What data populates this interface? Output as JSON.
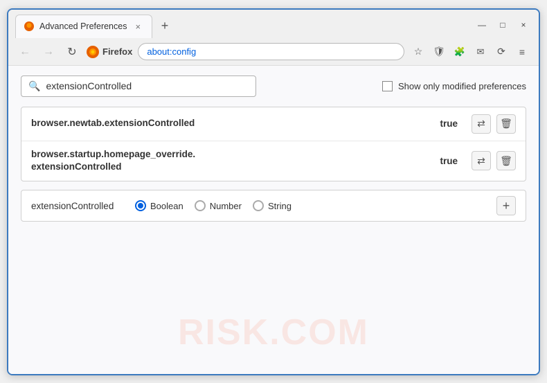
{
  "window": {
    "title": "Advanced Preferences",
    "tab_close": "×",
    "tab_new": "+",
    "win_min": "—",
    "win_max": "□",
    "win_close": "×"
  },
  "navbar": {
    "back_icon": "←",
    "forward_icon": "→",
    "reload_icon": "↻",
    "browser_label": "Firefox",
    "address": "about:config",
    "bookmark_icon": "☆",
    "shield_icon": "🛡",
    "extension_icon": "🧩",
    "mail_icon": "✉",
    "sync_icon": "⟳",
    "menu_icon": "≡"
  },
  "search": {
    "placeholder": "extensionControlled",
    "value": "extensionControlled",
    "show_modified_label": "Show only modified preferences"
  },
  "preferences": [
    {
      "name": "browser.newtab.extensionControlled",
      "value": "true"
    },
    {
      "name": "browser.startup.homepage_override.\nextensionControlled",
      "value": "true",
      "multiline": true,
      "name_line1": "browser.startup.homepage_override.",
      "name_line2": "extensionControlled"
    }
  ],
  "add_pref": {
    "name": "extensionControlled",
    "radio_options": [
      {
        "label": "Boolean",
        "selected": true
      },
      {
        "label": "Number",
        "selected": false
      },
      {
        "label": "String",
        "selected": false
      }
    ],
    "add_label": "+"
  },
  "watermark": "RISK.COM",
  "icons": {
    "swap": "⇄",
    "delete": "🗑",
    "search": "🔍"
  }
}
